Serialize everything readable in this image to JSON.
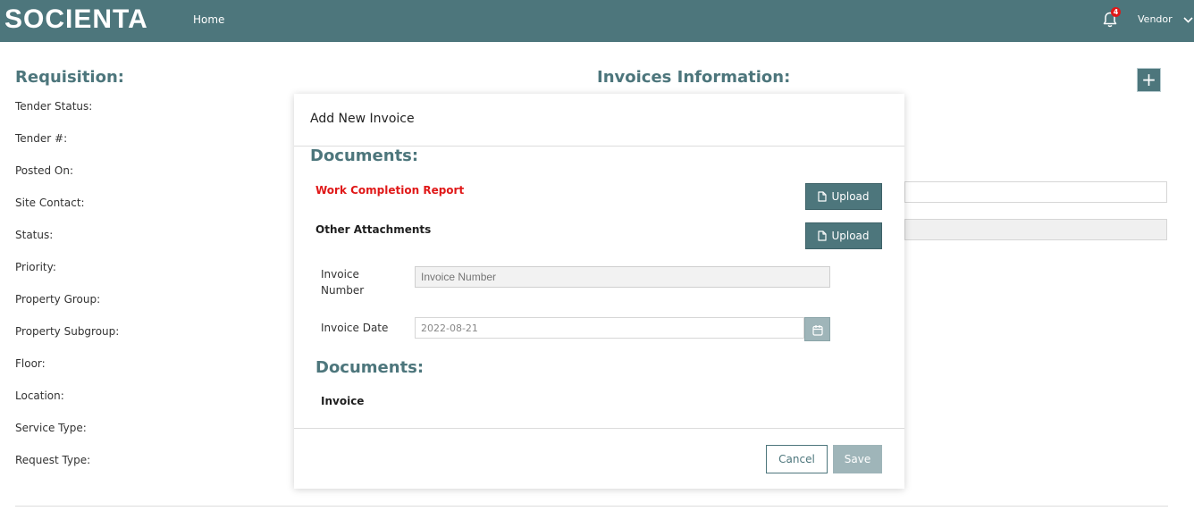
{
  "header": {
    "logo": "SOCIENTA",
    "nav_home": "Home",
    "notification_count": "4",
    "user_menu": "Vendor"
  },
  "requisition": {
    "title": "Requisition:",
    "fields": [
      "Tender Status:",
      "Tender #:",
      "Posted On:",
      "Site Contact:",
      "Status:",
      "Priority:",
      "Property Group:",
      "Property Subgroup:",
      "Floor:",
      "Location:",
      "Service Type:",
      "Request Type:"
    ]
  },
  "invoices": {
    "title": "Invoices Information:",
    "add_label": "+"
  },
  "modal": {
    "title": "Add New Invoice",
    "documents_heading": "Documents:",
    "work_completion_label": "Work Completion Report",
    "other_attachments_label": "Other Attachments",
    "upload_label": "Upload",
    "invoice_number_label": "Invoice Number",
    "invoice_number_placeholder": "Invoice Number",
    "invoice_date_label": "Invoice Date",
    "invoice_date_value": "2022-08-21",
    "documents_heading_2": "Documents:",
    "invoice_doc_label": "Invoice",
    "cancel_label": "Cancel",
    "save_label": "Save"
  },
  "colors": {
    "brand": "#4d767c",
    "required": "#e01818",
    "disabled_button": "#9fb5b9"
  },
  "icons": [
    "bell-icon",
    "chevron-down-icon",
    "plus-icon",
    "file-icon",
    "calendar-icon"
  ]
}
